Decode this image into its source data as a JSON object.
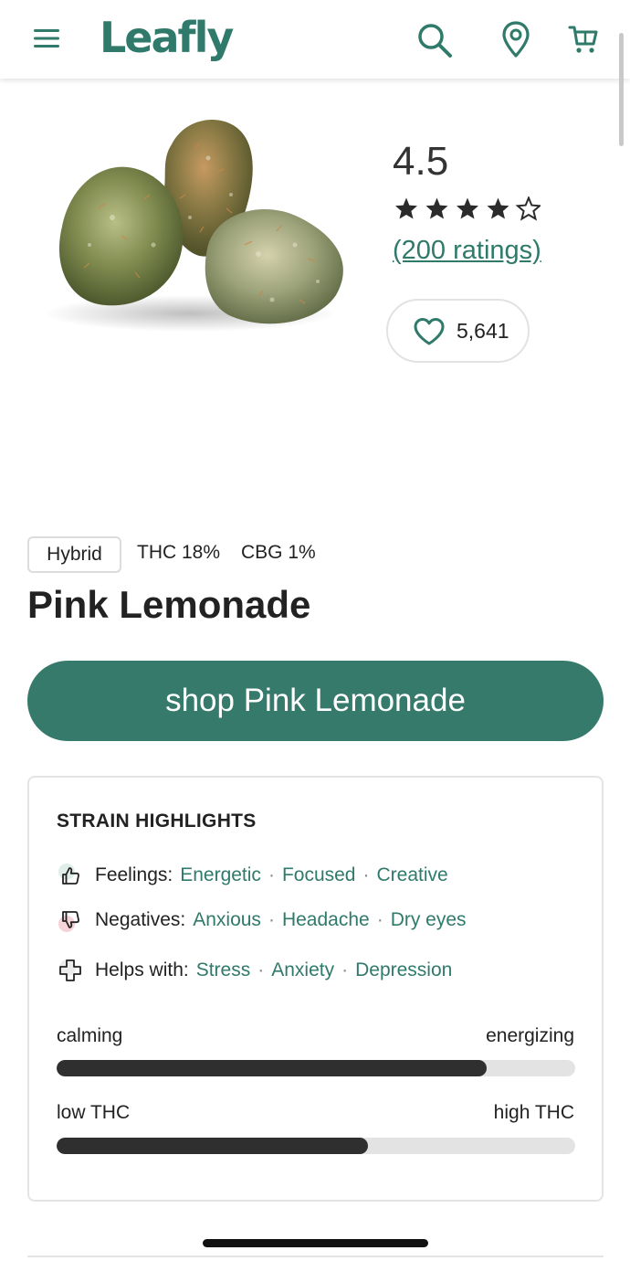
{
  "header": {
    "logo_text": "Leafly",
    "brand_color": "#2f7a6a",
    "icons": [
      "menu-icon",
      "search-icon",
      "location-icon",
      "cart-icon"
    ]
  },
  "product": {
    "image": "strain-bud-photo",
    "rating_value": "4.5",
    "star_rating": 4.5,
    "ratings_link": "(200 ratings)",
    "favorite_count": "5,641",
    "type": "Hybrid",
    "thc": "THC 18%",
    "cbg": "CBG 1%",
    "name": "Pink Lemonade",
    "shop_button": "shop Pink Lemonade",
    "shop_button_color": "#367a6b"
  },
  "highlights": {
    "title": "STRAIN HIGHLIGHTS",
    "feelings": {
      "label": "Feelings:",
      "items": [
        "Energetic",
        "Focused",
        "Creative"
      ],
      "separator": "·"
    },
    "negatives": {
      "label": "Negatives:",
      "items": [
        "Anxious",
        "Headache",
        "Dry eyes"
      ],
      "separator": "·"
    },
    "helps": {
      "label": "Helps with:",
      "items": [
        "Stress",
        "Anxiety",
        "Depression"
      ],
      "separator": "·"
    },
    "scales": [
      {
        "left": "calming",
        "right": "energizing",
        "value": 0.83
      },
      {
        "left": "low THC",
        "right": "high THC",
        "value": 0.6
      }
    ]
  }
}
